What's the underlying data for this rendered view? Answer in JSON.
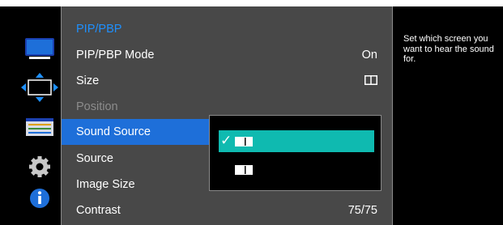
{
  "menu": {
    "title": "PIP/PBP",
    "items": [
      {
        "label": "PIP/PBP Mode",
        "value": "On"
      },
      {
        "label": "Size",
        "value": ""
      },
      {
        "label": "Position",
        "value": ""
      },
      {
        "label": "Sound Source",
        "value": ""
      },
      {
        "label": "Source",
        "value": ""
      },
      {
        "label": "Image Size",
        "value": ""
      },
      {
        "label": "Contrast",
        "value": "75/75"
      }
    ]
  },
  "help": {
    "text": "Set which screen you want to hear the sound for."
  },
  "popup": {
    "options": [
      {
        "icon": "pip-main-screen-icon",
        "checked": true
      },
      {
        "icon": "pip-sub-screen-icon",
        "checked": false
      }
    ],
    "check_glyph": "✓"
  },
  "sidebar": {
    "icons": [
      "picture-icon",
      "onscreen-display-icon",
      "system-icon",
      "settings-icon",
      "information-icon"
    ]
  },
  "colors": {
    "accent": "#1e6fd9",
    "title": "#1e90ff",
    "menu_bg": "#484848",
    "popup_selected": "#0fbab0",
    "dim_text": "#8c8c8c"
  }
}
